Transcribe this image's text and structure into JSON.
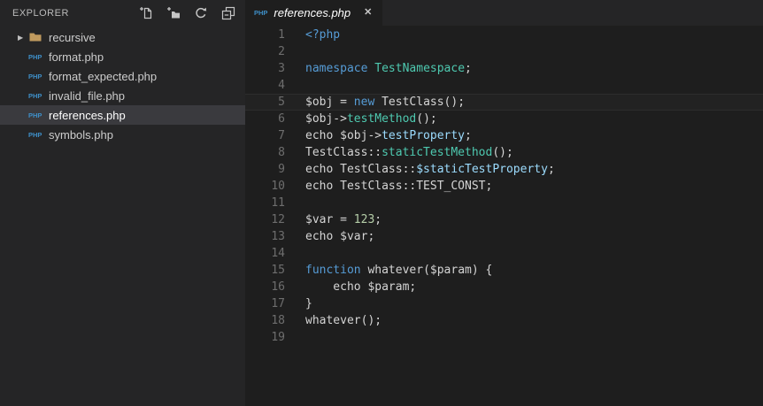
{
  "colors": {
    "editor_bg": "#1E1E1E",
    "sidebar_bg": "#252526",
    "tabbar_bg": "#252526",
    "active_tab_bg": "#1E1E1E",
    "selected_row_bg": "#3A3A3E",
    "current_line_bg": "#222222",
    "current_line_border": "#2D2D2D",
    "line_number": "#6E6E6E",
    "text_ui": "#CCCCCC",
    "explorer_title": "#BBBBBB",
    "icon": "#C5C5C5",
    "php_badge": "#3E8FC8",
    "folder": "#C09A5E",
    "tab_label": "#FFFFFF",
    "tokens": {
      "k": "#569CD6",
      "c": "#4EC9B0",
      "v": "#9CDCFE",
      "n": "#B5CEA8",
      "p": "#D4D4D4"
    }
  },
  "explorer": {
    "title": "EXPLORER",
    "actions": [
      {
        "name": "new-file",
        "title": "New File"
      },
      {
        "name": "new-folder",
        "title": "New Folder"
      },
      {
        "name": "refresh",
        "title": "Refresh"
      },
      {
        "name": "collapse-all",
        "title": "Collapse All"
      }
    ],
    "items": [
      {
        "label": "recursive",
        "type": "folder",
        "selected": false
      },
      {
        "label": "format.php",
        "type": "php",
        "selected": false
      },
      {
        "label": "format_expected.php",
        "type": "php",
        "selected": false
      },
      {
        "label": "invalid_file.php",
        "type": "php",
        "selected": false
      },
      {
        "label": "references.php",
        "type": "php",
        "selected": true
      },
      {
        "label": "symbols.php",
        "type": "php",
        "selected": false
      }
    ],
    "folder_chevron_glyph": "▶",
    "php_icon_text": "PHP"
  },
  "tab": {
    "label": "references.php",
    "close_glyph": "✕",
    "php_icon_text": "PHP"
  },
  "editor": {
    "lines": [
      {
        "num": "1",
        "current": false,
        "tokens": [
          [
            "k",
            "<?php"
          ]
        ]
      },
      {
        "num": "2",
        "current": false,
        "tokens": []
      },
      {
        "num": "3",
        "current": false,
        "tokens": [
          [
            "k",
            "namespace"
          ],
          [
            "p",
            " "
          ],
          [
            "c",
            "TestNamespace"
          ],
          [
            "p",
            ";"
          ]
        ]
      },
      {
        "num": "4",
        "current": false,
        "tokens": []
      },
      {
        "num": "5",
        "current": true,
        "tokens": [
          [
            "p",
            "$obj = "
          ],
          [
            "k",
            "new"
          ],
          [
            "p",
            " TestClass();"
          ]
        ]
      },
      {
        "num": "6",
        "current": false,
        "tokens": [
          [
            "p",
            "$obj->"
          ],
          [
            "c",
            "testMethod"
          ],
          [
            "p",
            "();"
          ]
        ]
      },
      {
        "num": "7",
        "current": false,
        "tokens": [
          [
            "p",
            "echo $obj->"
          ],
          [
            "v",
            "testProperty"
          ],
          [
            "p",
            ";"
          ]
        ]
      },
      {
        "num": "8",
        "current": false,
        "tokens": [
          [
            "p",
            "TestClass::"
          ],
          [
            "c",
            "staticTestMethod"
          ],
          [
            "p",
            "();"
          ]
        ]
      },
      {
        "num": "9",
        "current": false,
        "tokens": [
          [
            "p",
            "echo TestClass::"
          ],
          [
            "v",
            "$staticTestProperty"
          ],
          [
            "p",
            ";"
          ]
        ]
      },
      {
        "num": "10",
        "current": false,
        "tokens": [
          [
            "p",
            "echo TestClass::TEST_CONST;"
          ]
        ]
      },
      {
        "num": "11",
        "current": false,
        "tokens": []
      },
      {
        "num": "12",
        "current": false,
        "tokens": [
          [
            "p",
            "$var = "
          ],
          [
            "n",
            "123"
          ],
          [
            "p",
            ";"
          ]
        ]
      },
      {
        "num": "13",
        "current": false,
        "tokens": [
          [
            "p",
            "echo $var;"
          ]
        ]
      },
      {
        "num": "14",
        "current": false,
        "tokens": []
      },
      {
        "num": "15",
        "current": false,
        "tokens": [
          [
            "k",
            "function"
          ],
          [
            "p",
            " whatever($param) {"
          ]
        ]
      },
      {
        "num": "16",
        "current": false,
        "tokens": [
          [
            "p",
            "    echo $param;"
          ]
        ]
      },
      {
        "num": "17",
        "current": false,
        "tokens": [
          [
            "p",
            "}"
          ]
        ]
      },
      {
        "num": "18",
        "current": false,
        "tokens": [
          [
            "p",
            "whatever();"
          ]
        ]
      },
      {
        "num": "19",
        "current": false,
        "tokens": []
      }
    ]
  }
}
